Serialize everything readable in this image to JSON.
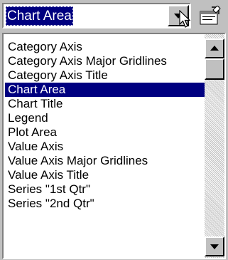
{
  "combo": {
    "selected_value": "Chart Area"
  },
  "list": {
    "items": [
      {
        "label": "Category Axis"
      },
      {
        "label": "Category Axis Major Gridlines"
      },
      {
        "label": "Category Axis Title"
      },
      {
        "label": "Chart Area"
      },
      {
        "label": "Chart Title"
      },
      {
        "label": "Legend"
      },
      {
        "label": "Plot Area"
      },
      {
        "label": "Value Axis"
      },
      {
        "label": "Value Axis Major Gridlines"
      },
      {
        "label": "Value Axis Title"
      },
      {
        "label": "Series \"1st Qtr\""
      },
      {
        "label": "Series \"2nd Qtr\""
      }
    ],
    "selected_index": 3
  },
  "icons": {
    "dropdown": "chevron-down-icon",
    "format": "format-object-icon",
    "cursor": "mouse-pointer-icon",
    "scroll_up": "arrow-up-icon",
    "scroll_down": "arrow-down-icon"
  },
  "colors": {
    "selection": "#000080",
    "face": "#c0c0c0",
    "window": "#ffffff"
  }
}
